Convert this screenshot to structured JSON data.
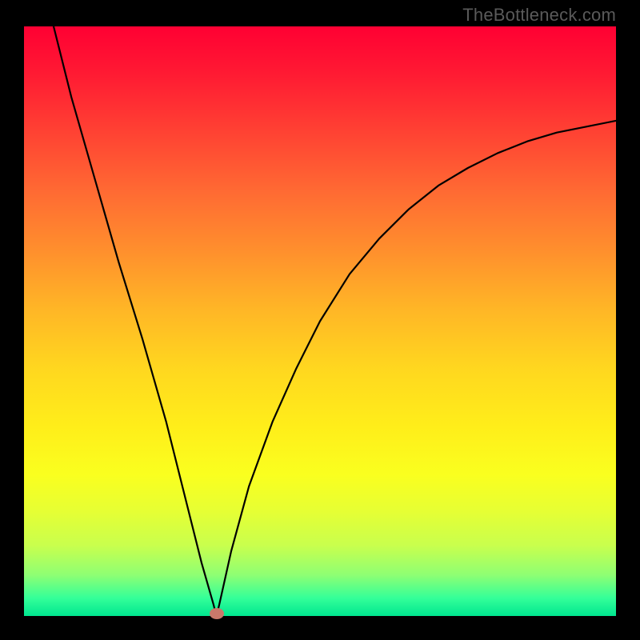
{
  "attribution": "TheBottleneck.com",
  "colors": {
    "frame": "#000000",
    "gradient_top": "#ff0033",
    "gradient_bottom": "#00e68f",
    "curve": "#000000",
    "marker": "#c9786a",
    "attribution_text": "#5a5a5a"
  },
  "chart_data": {
    "type": "line",
    "title": "",
    "xlabel": "",
    "ylabel": "",
    "xlim": [
      0,
      100
    ],
    "ylim": [
      0,
      100
    ],
    "note": "Bottleneck-style V curve. Minimum at x≈32.5. y=0 is bottom (green/ideal), y=100 is top (red/worst).",
    "x": [
      5,
      8,
      12,
      16,
      20,
      24,
      28,
      30,
      32,
      32.5,
      33,
      35,
      38,
      42,
      46,
      50,
      55,
      60,
      65,
      70,
      75,
      80,
      85,
      90,
      95,
      100
    ],
    "y": [
      100,
      88,
      74,
      60,
      47,
      33,
      17,
      9,
      2,
      0,
      2,
      11,
      22,
      33,
      42,
      50,
      58,
      64,
      69,
      73,
      76,
      78.5,
      80.5,
      82,
      83,
      84
    ],
    "marker": {
      "x": 32.5,
      "y": 0
    }
  }
}
